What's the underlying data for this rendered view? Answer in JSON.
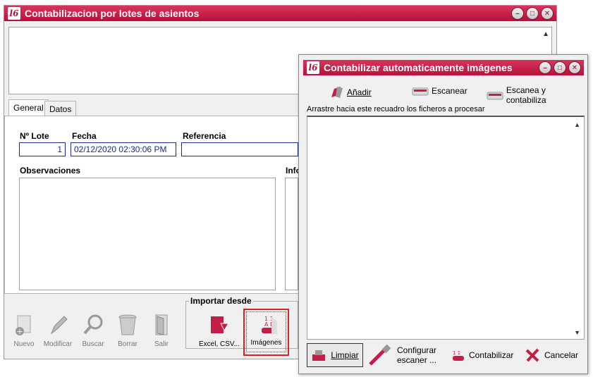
{
  "main_window": {
    "title": "Contabilizacion por lotes de asientos",
    "logo": "l6",
    "tabs": [
      {
        "label": "General",
        "active": true
      },
      {
        "label": "Datos",
        "active": false
      }
    ],
    "fields": {
      "lote_label": "Nº Lote",
      "lote_value": "1",
      "fecha_label": "Fecha",
      "fecha_value": "02/12/2020 02:30:06 PM",
      "referencia_label": "Referencia",
      "referencia_value": "",
      "observaciones_label": "Observaciones",
      "info_label": "Info"
    },
    "toolbar": {
      "nuevo": "Nuevo",
      "modificar": "Modificar",
      "buscar": "Buscar",
      "borrar": "Borrar",
      "salir": "Salir"
    },
    "import": {
      "legend": "Importar desde",
      "excel": "Excel, CSV...",
      "imagenes": "Imágenes"
    },
    "highlight_color": "#e02020"
  },
  "dialog": {
    "title": "Contabilizar automaticamente imágenes",
    "logo": "l6",
    "tools": {
      "anadir": "Añadir",
      "escanear": "Escanear",
      "escanea_contabiliza": "Escanea y contabiliza"
    },
    "drop_hint": "Arrastre hacia este recuadro los ficheros a procesar",
    "buttons": {
      "limpiar": "Limpiar",
      "configurar_1": "Configurar",
      "configurar_2": "escaner ...",
      "contabilizar": "Contabilizar",
      "cancelar": "Cancelar"
    }
  },
  "colors": {
    "titlebar": "#c41e47",
    "field_border": "#1c2a8c",
    "accent": "#c41e47"
  }
}
